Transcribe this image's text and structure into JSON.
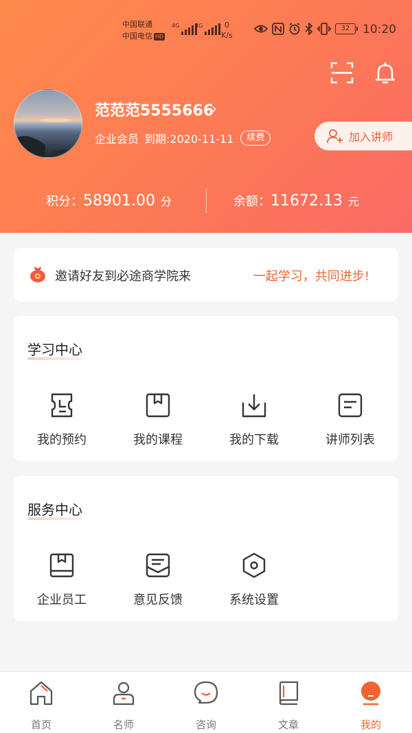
{
  "status_bar": {
    "carrier_1": "中国联通",
    "carrier_2": "中国电信",
    "hd": "HD",
    "net_1": "4G",
    "net_2": "4G",
    "speed_value": "0",
    "speed_unit": "K/s",
    "battery": "32",
    "time": "10:20"
  },
  "profile": {
    "username": "范范范5555666",
    "member_type": "企业会员",
    "expiry": "到期:2020-11-11",
    "renew": "续费",
    "join_button": "加入讲师"
  },
  "stats": {
    "points_label": "积分：",
    "points_value": "58901.00",
    "points_unit": "分",
    "balance_label": "余额：",
    "balance_value": "11672.13",
    "balance_unit": "元"
  },
  "invite": {
    "text": "邀请好友到必途商学院来",
    "slogan": "一起学习，共同进步!"
  },
  "learning_center": {
    "title": "学习中心",
    "items": [
      {
        "label": "我的预约",
        "icon": "appointment-icon"
      },
      {
        "label": "我的课程",
        "icon": "course-icon"
      },
      {
        "label": "我的下载",
        "icon": "download-icon"
      },
      {
        "label": "讲师列表",
        "icon": "list-icon"
      }
    ]
  },
  "service_center": {
    "title": "服务中心",
    "items": [
      {
        "label": "企业员工",
        "icon": "employee-icon"
      },
      {
        "label": "意见反馈",
        "icon": "feedback-icon"
      },
      {
        "label": "系统设置",
        "icon": "settings-icon"
      }
    ]
  },
  "tabbar": {
    "items": [
      {
        "label": "首页",
        "icon": "home-icon"
      },
      {
        "label": "名师",
        "icon": "teacher-icon"
      },
      {
        "label": "咨询",
        "icon": "chat-icon"
      },
      {
        "label": "文章",
        "icon": "article-icon"
      },
      {
        "label": "我的",
        "icon": "profile-icon"
      }
    ],
    "active": "我的"
  },
  "colors": {
    "accent": "#f0642f",
    "header_start": "#fe8a4c",
    "header_end": "#fb6a66"
  }
}
